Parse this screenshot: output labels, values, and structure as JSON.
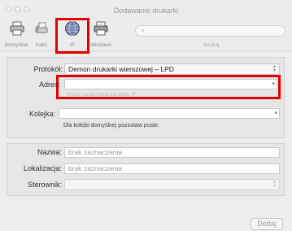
{
  "window": {
    "title": "Dodawanie drukarki"
  },
  "toolbar": {
    "items": [
      {
        "label": "Domyślne",
        "icon": "printer-icon"
      },
      {
        "label": "Faks",
        "icon": "fax-icon"
      },
      {
        "label": "IP",
        "icon": "globe-icon"
      },
      {
        "label": "Windows",
        "icon": "windows-printer-icon"
      }
    ],
    "search_label": "Szukaj",
    "search_placeholder": ""
  },
  "form": {
    "protocol_label": "Protokół:",
    "protocol_value": "Demon drukarki wierszowej – LPD",
    "address_label": "Adres:",
    "address_value": "",
    "address_hint": "Wpisz nazwę hosta lub adres IP.",
    "queue_label": "Kolejka:",
    "queue_value": "",
    "queue_hint": "Dla kolejki domyślnej pozostaw puste."
  },
  "details": {
    "name_label": "Nazwa:",
    "name_value": "brak zaznaczenia",
    "location_label": "Lokalizacja:",
    "location_value": "brak zaznaczenia",
    "driver_label": "Sterownik:",
    "driver_value": ""
  },
  "footer": {
    "add_label": "Dodaj"
  },
  "colors": {
    "highlight": "#e00000"
  }
}
